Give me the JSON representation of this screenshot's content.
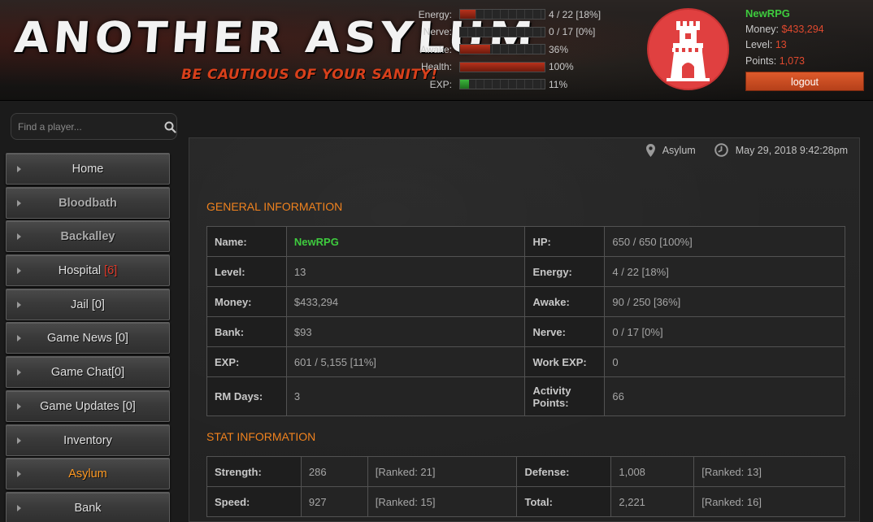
{
  "header": {
    "logo_title": "ANOTHER ASYLUM",
    "tagline": "BE CAUTIOUS OF YOUR SANITY!",
    "bars": [
      {
        "label": "Energy:",
        "value": "4 / 22 [18%]",
        "fill": 0.18,
        "color": "#b8321c"
      },
      {
        "label": "Nerve:",
        "value": "0 / 17 [0%]",
        "fill": 0.0,
        "color": "#b8321c"
      },
      {
        "label": "Awake:",
        "value": "36%",
        "fill": 0.36,
        "color": "#b8321c"
      },
      {
        "label": "Health:",
        "value": "100%",
        "fill": 1.0,
        "color": "#b8321c"
      },
      {
        "label": "EXP:",
        "value": "11%",
        "fill": 0.11,
        "color": "#3bb53b"
      }
    ],
    "avatar_icon": "castle-tower-icon",
    "user": {
      "name": "NewRPG",
      "money_label": "Money:",
      "money": "$433,294",
      "level_label": "Level:",
      "level": "13",
      "points_label": "Points:",
      "points": "1,073"
    },
    "logout_label": "logout"
  },
  "sidebar": {
    "search_placeholder": "Find a player...",
    "items": [
      {
        "label": "Home",
        "badge": "",
        "style": "normal"
      },
      {
        "label": "Bloodbath",
        "badge": "",
        "style": "muted"
      },
      {
        "label": "Backalley",
        "badge": "",
        "style": "muted"
      },
      {
        "label": "Hospital",
        "badge": "[6]",
        "style": "normal"
      },
      {
        "label": "Jail [0]",
        "badge": "",
        "style": "normal"
      },
      {
        "label": "Game News [0]",
        "badge": "",
        "style": "normal"
      },
      {
        "label": "Game Chat[0]",
        "badge": "",
        "style": "normal"
      },
      {
        "label": "Game Updates [0]",
        "badge": "",
        "style": "normal"
      },
      {
        "label": "Inventory",
        "badge": "",
        "style": "normal"
      },
      {
        "label": "Asylum",
        "badge": "",
        "style": "active"
      },
      {
        "label": "Bank",
        "badge": "",
        "style": "normal"
      }
    ]
  },
  "main": {
    "location": "Asylum",
    "datetime": "May 29, 2018 9:42:28pm",
    "general_title": "GENERAL INFORMATION",
    "general_rows": [
      {
        "k1": "Name:",
        "v1": "NewRPG",
        "k2": "HP:",
        "v2": "650 / 650 [100%]"
      },
      {
        "k1": "Level:",
        "v1": "13",
        "k2": "Energy:",
        "v2": "4 / 22 [18%]"
      },
      {
        "k1": "Money:",
        "v1": "$433,294",
        "k2": "Awake:",
        "v2": "90 / 250 [36%]"
      },
      {
        "k1": "Bank:",
        "v1": "$93",
        "k2": "Nerve:",
        "v2": "0 / 17 [0%]"
      },
      {
        "k1": "EXP:",
        "v1": "601 / 5,155 [11%]",
        "k2": "Work EXP:",
        "v2": "0"
      },
      {
        "k1": "RM Days:",
        "v1": "3",
        "k2": "Activity Points:",
        "v2": "66"
      }
    ],
    "stat_title": "STAT INFORMATION",
    "stat_rows": [
      {
        "k1": "Strength:",
        "v1": "286",
        "r1": "[Ranked: 21]",
        "k2": "Defense:",
        "v2": "1,008",
        "r2": "[Ranked: 13]"
      },
      {
        "k1": "Speed:",
        "v1": "927",
        "r1": "[Ranked: 15]",
        "k2": "Total:",
        "v2": "2,221",
        "r2": "[Ranked: 16]"
      }
    ]
  }
}
